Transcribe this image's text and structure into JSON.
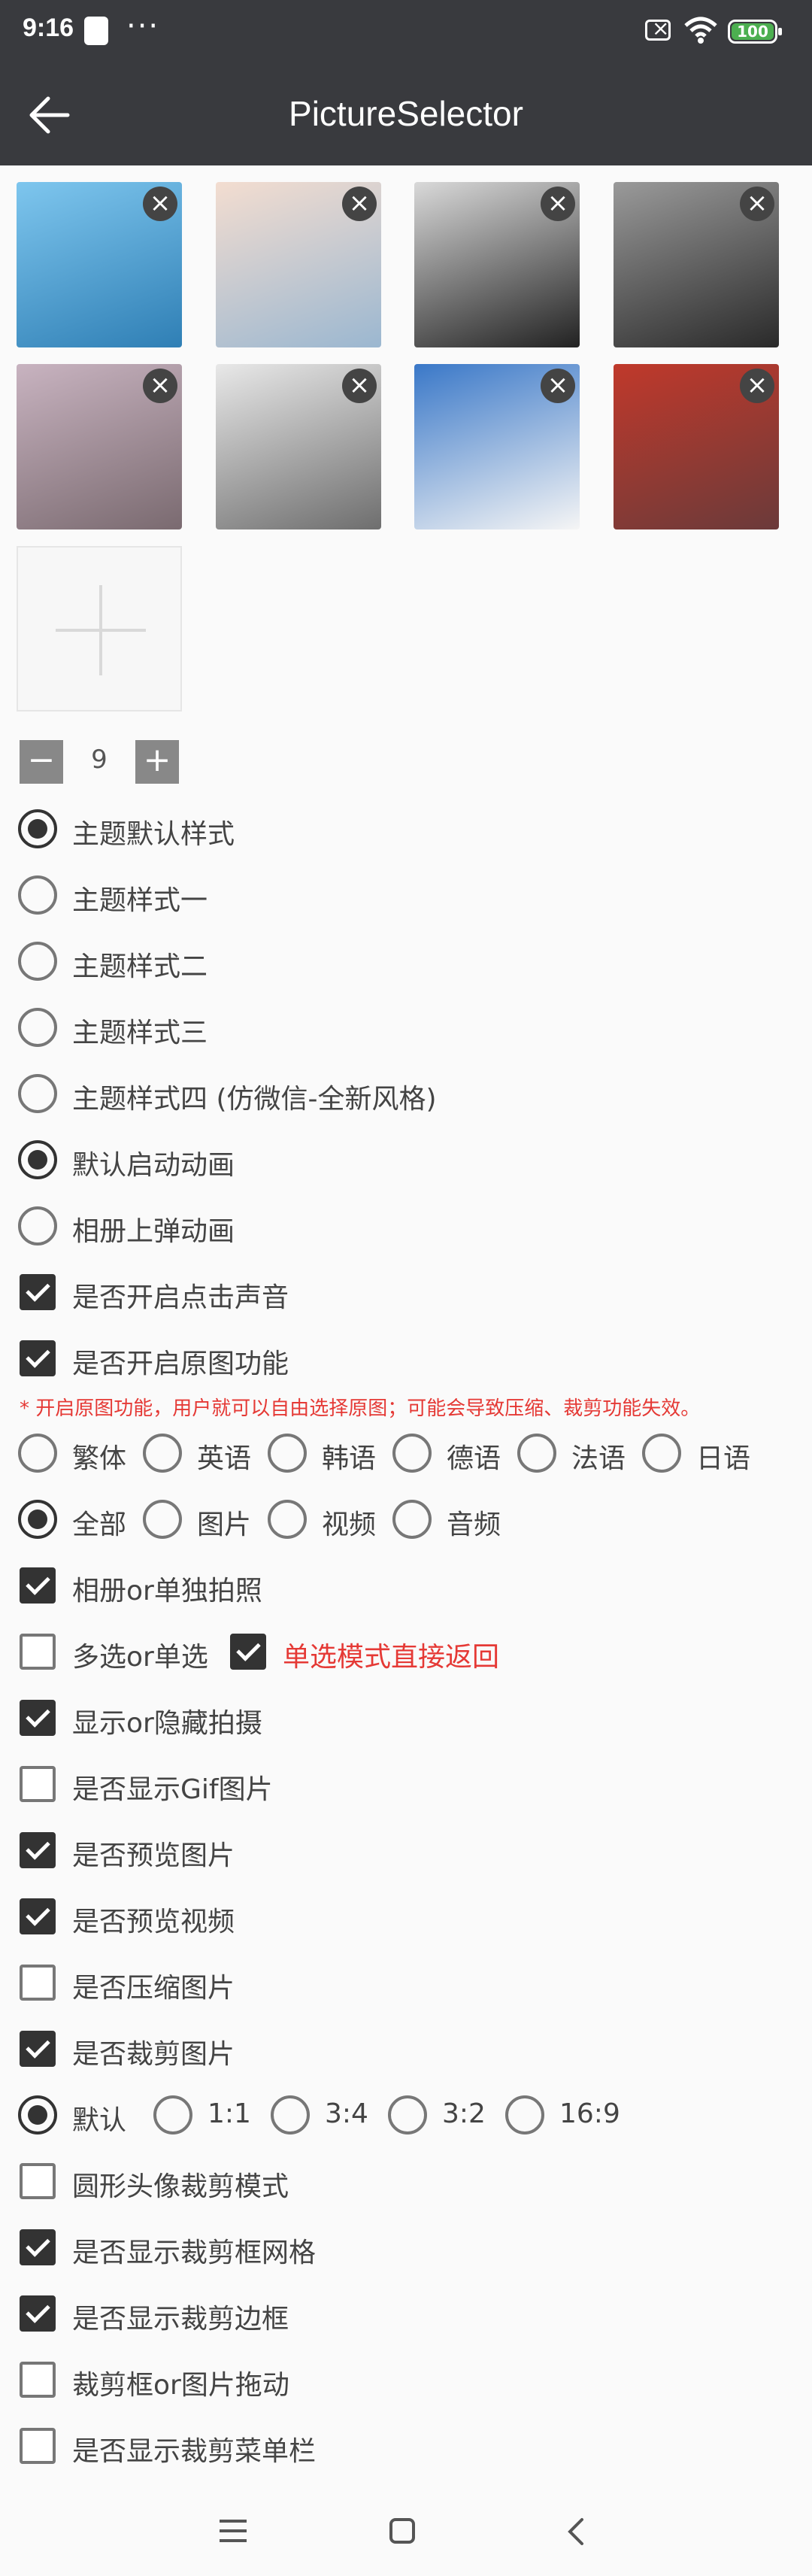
{
  "status_bar": {
    "time": "9:16",
    "battery": "100"
  },
  "header": {
    "title": "PictureSelector"
  },
  "images": [
    {
      "icon": "photo-thumbnail",
      "colors": [
        "#7ec6ee",
        "#2f7fb5"
      ]
    },
    {
      "icon": "photo-thumbnail",
      "colors": [
        "#f3ddd0",
        "#9bb7d0"
      ]
    },
    {
      "icon": "photo-thumbnail",
      "colors": [
        "#d9d9d9",
        "#222222"
      ]
    },
    {
      "icon": "photo-thumbnail",
      "colors": [
        "#9a9a9a",
        "#2a2a2a"
      ]
    },
    {
      "icon": "photo-thumbnail",
      "colors": [
        "#c8b3c0",
        "#7a6a70"
      ]
    },
    {
      "icon": "photo-thumbnail",
      "colors": [
        "#e8e8e8",
        "#6e6e6e"
      ]
    },
    {
      "icon": "photo-thumbnail",
      "colors": [
        "#3a78c8",
        "#f5f5f5"
      ]
    },
    {
      "icon": "photo-thumbnail",
      "colors": [
        "#c0392b",
        "#6b3a3a"
      ]
    }
  ],
  "delete_symbol": "×",
  "stepper": {
    "minus": "−",
    "value": "9",
    "plus": "+"
  },
  "themes": [
    {
      "label": "主题默认样式",
      "checked": true
    },
    {
      "label": "主题样式一",
      "checked": false
    },
    {
      "label": "主题样式二",
      "checked": false
    },
    {
      "label": "主题样式三",
      "checked": false
    },
    {
      "label": "主题样式四 (仿微信-全新风格)",
      "checked": false
    }
  ],
  "animations": [
    {
      "label": "默认启动动画",
      "checked": true
    },
    {
      "label": "相册上弹动画",
      "checked": false
    }
  ],
  "checks_a": [
    {
      "label": "是否开启点击声音",
      "checked": true
    },
    {
      "label": "是否开启原图功能",
      "checked": true
    }
  ],
  "original_warning": "* 开启原图功能，用户就可以自由选择原图；可能会导致压缩、裁剪功能失效。",
  "languages": [
    {
      "label": "繁体",
      "checked": false
    },
    {
      "label": "英语",
      "checked": false
    },
    {
      "label": "韩语",
      "checked": false
    },
    {
      "label": "德语",
      "checked": false
    },
    {
      "label": "法语",
      "checked": false
    },
    {
      "label": "日语",
      "checked": false
    }
  ],
  "media_types": [
    {
      "label": "全部",
      "checked": true
    },
    {
      "label": "图片",
      "checked": false
    },
    {
      "label": "视频",
      "checked": false
    },
    {
      "label": "音频",
      "checked": false
    }
  ],
  "camera_only": {
    "label": "相册or单独拍照",
    "checked": true
  },
  "multi_select": {
    "label": "多选or单选",
    "checked": false
  },
  "single_return": {
    "label": "单选模式直接返回",
    "checked": true
  },
  "checks_b": [
    {
      "label": "显示or隐藏拍摄",
      "checked": true
    },
    {
      "label": "是否显示Gif图片",
      "checked": false
    },
    {
      "label": "是否预览图片",
      "checked": true
    },
    {
      "label": "是否预览视频",
      "checked": true
    },
    {
      "label": "是否压缩图片",
      "checked": false
    },
    {
      "label": "是否裁剪图片",
      "checked": true
    }
  ],
  "crop_ratios": [
    {
      "label": "默认",
      "checked": true
    },
    {
      "label": "1:1",
      "checked": false
    },
    {
      "label": "3:4",
      "checked": false
    },
    {
      "label": "3:2",
      "checked": false
    },
    {
      "label": "16:9",
      "checked": false
    }
  ],
  "checks_c": [
    {
      "label": "圆形头像裁剪模式",
      "checked": false
    },
    {
      "label": "是否显示裁剪框网格",
      "checked": true
    },
    {
      "label": "是否显示裁剪边框",
      "checked": true
    },
    {
      "label": "裁剪框or图片拖动",
      "checked": false
    },
    {
      "label": "是否显示裁剪菜单栏",
      "checked": false
    }
  ]
}
